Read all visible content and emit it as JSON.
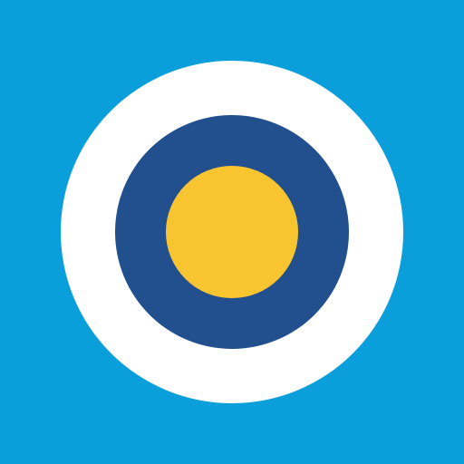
{
  "icon": {
    "name": "roundel-target-icon",
    "colors": {
      "background": "#0a9fdb",
      "outer_ring": "#ffffff",
      "middle_ring": "#22508e",
      "center": "#f8c531"
    }
  }
}
